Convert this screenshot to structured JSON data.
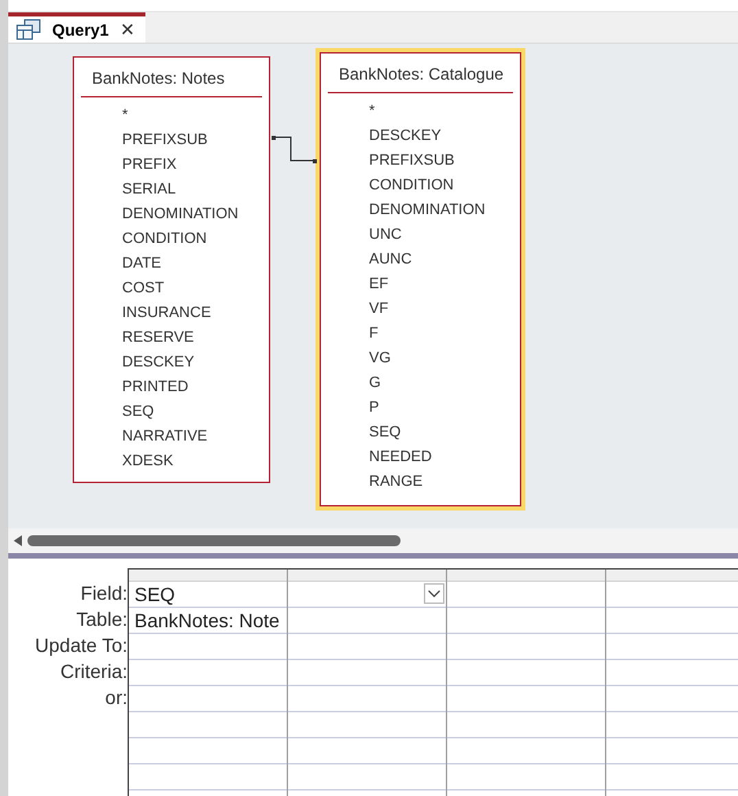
{
  "tabs": [
    {
      "label": "Query1",
      "selected": true,
      "close": "✕"
    }
  ],
  "tables": [
    {
      "title": "BankNotes: Notes",
      "selected": false,
      "fields": [
        "*",
        "PREFIXSUB",
        "PREFIX",
        "SERIAL",
        "DENOMINATION",
        "CONDITION",
        "DATE",
        "COST",
        "INSURANCE",
        "RESERVE",
        "DESCKEY",
        "PRINTED",
        "SEQ",
        "NARRATIVE",
        "XDESK"
      ]
    },
    {
      "title": "BankNotes: Catalogue",
      "selected": true,
      "fields": [
        "*",
        "DESCKEY",
        "PREFIXSUB",
        "CONDITION",
        "DENOMINATION",
        "UNC",
        "AUNC",
        "EF",
        "VF",
        "F",
        "VG",
        "G",
        "P",
        "SEQ",
        "NEEDED",
        "RANGE"
      ]
    }
  ],
  "grid": {
    "row_labels": [
      "Field:",
      "Table:",
      "Update To:",
      "Criteria:",
      "or:"
    ],
    "columns": [
      {
        "cells": [
          "SEQ",
          "BankNotes: Note"
        ],
        "dropdown": false
      },
      {
        "dropdown": true
      },
      {
        "dropdown": false
      },
      {
        "dropdown": false
      }
    ]
  }
}
